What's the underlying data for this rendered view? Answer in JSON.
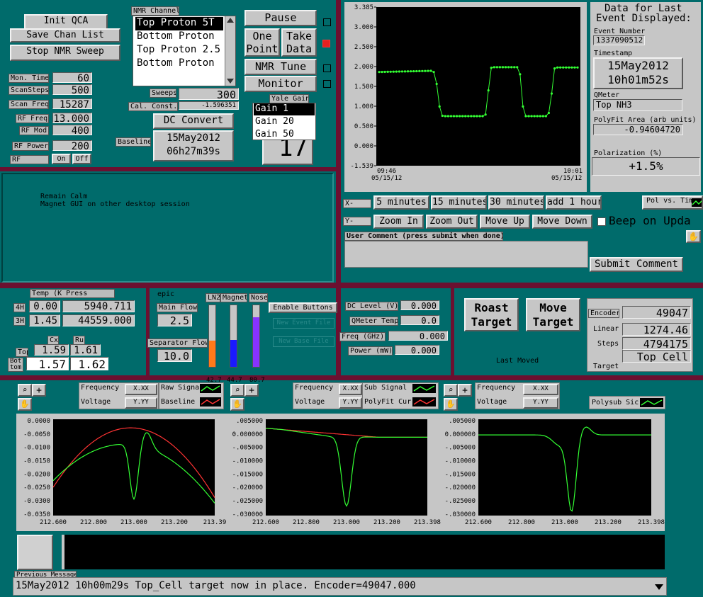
{
  "top_left": {
    "init_qca": "Init QCA",
    "save_chan_list": "Save Chan List",
    "stop_nmr_sweep": "Stop NMR Sweep"
  },
  "params": [
    {
      "label": "Mon. Time",
      "value": "60"
    },
    {
      "label": "ScanSteps",
      "value": "500"
    },
    {
      "label": "Scan Freq",
      "value": "15287"
    },
    {
      "label": "RF Freq",
      "value": "13.000"
    },
    {
      "label": "RF Mod",
      "value": "400"
    },
    {
      "label": "RF Power",
      "value": "200"
    }
  ],
  "rf": {
    "label": "RF",
    "on": "On",
    "off": "Off"
  },
  "nmr_channel": {
    "title": "NMR Channel",
    "items": [
      "Top Proton 5T",
      "Bottom Proton",
      "Top Proton 2.5",
      "Bottom Proton"
    ],
    "selected": 0
  },
  "sweeps": {
    "label": "Sweeps",
    "value": "300"
  },
  "cal_const": {
    "label": "Cal. Const.",
    "value": "-1.596351"
  },
  "dc_convert": {
    "label": "DC Convert"
  },
  "baseline": {
    "label": "Baseline",
    "date": "15May2012",
    "time": "06h27m39s"
  },
  "controls": {
    "pause": "Pause",
    "one_point_1": "One",
    "one_point_2": "Point",
    "take_data_1": "Take",
    "take_data_2": "Data",
    "nmr_tune": "NMR Tune",
    "monitor": "Monitor"
  },
  "yale_gain": {
    "title": "Yale Gain",
    "items": [
      "Gain 1",
      "Gain 20",
      "Gain 50"
    ],
    "selected": 0,
    "counter": "17"
  },
  "message_area": {
    "line1": "Remain Calm",
    "line2": "Magnet GUI on other desktop session"
  },
  "main_plot": {
    "yticks": [
      "3.385",
      "3.000",
      "2.500",
      "2.000",
      "1.500",
      "1.000",
      "0.500",
      "0.000",
      "-1.539"
    ],
    "x_start_time": "09:46",
    "x_start_date": "05/15/12",
    "x_end_time": "10:01",
    "x_end_date": "05/15/12",
    "color": "#33ff33"
  },
  "last_event": {
    "title1": "Data for Last",
    "title2": "Event Displayed:",
    "event_number_label": "Event Number",
    "event_number": "1337090512",
    "timestamp_label": "Timestamp",
    "ts_date": "15May2012",
    "ts_time": "10h01m52s",
    "qmeter_label": "QMeter",
    "qmeter": "Top NH3",
    "polyfit_label": "PolyFit Area (arb units)",
    "polyfit": "-0.94604720",
    "polarization_label": "Polarization (%)",
    "polarization": "+1.5%"
  },
  "x_controls": {
    "label": "X-",
    "b1": "5 minutes",
    "b2": "15 minutes",
    "b3": "30 minutes",
    "b4": "add 1 hour",
    "pol_vs": "Pol vs. Tim"
  },
  "y_controls": {
    "label": "Y-",
    "b1": "Zoom In",
    "b2": "Zoom Out",
    "b3": "Move Up",
    "b4": "Move Down",
    "beep": "Beep on Upda"
  },
  "comment": {
    "label": "User Comment (press submit when done)",
    "submit": "Submit Comment"
  },
  "temp": {
    "title": "Temp (K Press",
    "rows": [
      {
        "label": "4H",
        "t": "0.00",
        "p": "5940.711"
      },
      {
        "label": "3H",
        "t": "1.45",
        "p": "44559.000"
      }
    ],
    "cx": "Cx",
    "ru": "Ru",
    "top_label": "Top",
    "top_cx": "1.59",
    "top_ru": "1.61",
    "bot_label1": "Bot",
    "bot_label2": "tom",
    "bot_cx": "1.57",
    "bot_ru": "1.62"
  },
  "flows": {
    "epic": "epic",
    "main_flow_label": "Main Flow",
    "main_flow": "2.5",
    "sep_flow_label": "Separator Flow",
    "sep_flow": "10.0",
    "ln2": "LN2",
    "magnet": "Magnet",
    "nose": "Nose",
    "ln2_top": "42.7",
    "magnet_top": "44.7",
    "nose_top": "80.7",
    "ln2_level": 0.42,
    "magnet_level": 0.44,
    "nose_level": 0.8,
    "ln2_color": "#ff7a1a",
    "magnet_color": "#1a1aff",
    "nose_color": "#8833ff"
  },
  "enable": {
    "enable": "Enable Buttons",
    "new_event": "New Event File",
    "new_base": "New Base File"
  },
  "dc_panel": {
    "rows": [
      {
        "label": "DC Level (V)",
        "value": "0.000"
      },
      {
        "label": "QMeter Temp",
        "value": "0.0"
      },
      {
        "label": "Freq (GHz)",
        "value": "0.000"
      },
      {
        "label": "Power (mW)",
        "value": "0.000"
      }
    ]
  },
  "target": {
    "roast1": "Roast",
    "roast2": "Target",
    "move1": "Move",
    "move2": "Target",
    "last_moved": "Last Moved",
    "encoder_label": "Encoder",
    "encoder": "49047",
    "linear_label": "Linear",
    "linear": "1274.46",
    "steps_label": "Steps",
    "steps": "4794175",
    "target_label": "Target",
    "target": "Top_Cell"
  },
  "plot_panels": [
    {
      "freq": "Frequency",
      "volt": "Voltage",
      "leg1": "Raw Signa",
      "leg2": "Baseline",
      "yticks": [
        "0.0000",
        "-0.0050",
        "-0.0100",
        "-0.0150",
        "-0.0200",
        "-0.0250",
        "-0.0300",
        "-0.0350"
      ],
      "xticks": [
        "212.600",
        "212.800",
        "213.000",
        "213.200",
        "213.39"
      ],
      "c1": "#33ff33",
      "c2": "#ff3333"
    },
    {
      "freq": "Frequency",
      "volt": "Voltage",
      "leg1": "Sub Signal",
      "leg2": "PolyFit Cur",
      "yticks": [
        ".005000",
        "0.000000",
        "-.005000",
        "-.010000",
        "-.015000",
        "-.020000",
        "-.025000",
        "-.030000"
      ],
      "xticks": [
        "212.600",
        "212.800",
        "213.000",
        "213.200",
        "213.398"
      ],
      "c1": "#33ff33",
      "c2": "#ff3333"
    },
    {
      "freq": "Frequency",
      "volt": "Voltage",
      "leg1": "Polysub Sic",
      "yticks": [
        ".005000",
        "0.000000",
        "-.005000",
        "-.010000",
        "-.015000",
        "-.020000",
        "-.025000",
        "-.030000"
      ],
      "xticks": [
        "212.600",
        "212.800",
        "213.000",
        "213.200",
        "213.398"
      ],
      "c1": "#33ff33"
    }
  ],
  "scale_labels": {
    "x": "X.XX",
    "y": "Y.YY"
  },
  "bottom": {
    "prev_label": "Previous Messages",
    "message": "15May2012 10h00m29s Top_Cell target now in place.  Encoder=49047.000"
  },
  "colors": {
    "bg": "#006b6b",
    "divider": "#6b1030",
    "panel": "#c6c6c6",
    "trace": "#33ff33"
  }
}
